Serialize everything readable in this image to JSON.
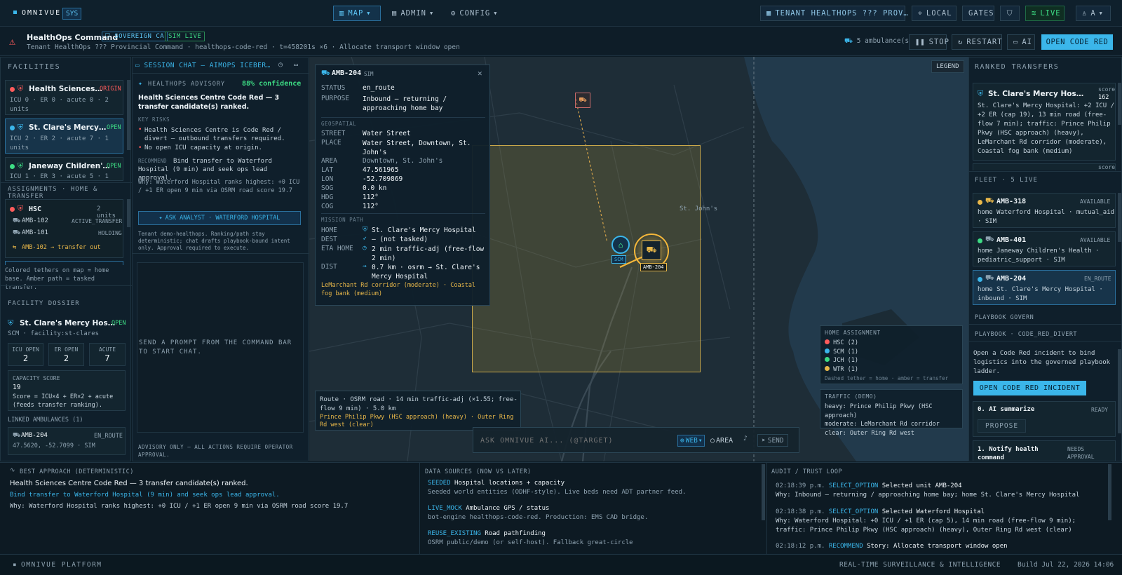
{
  "topbar": {
    "brand": "OMNIVUE",
    "sys": "SYS",
    "nav": [
      "MAP",
      "ADMIN",
      "CONFIG"
    ],
    "tenant": "TENANT HEALTHOPS ??? PROV…",
    "local": "LOCAL",
    "gates": "GATES",
    "live": "LIVE",
    "user": "A"
  },
  "command": {
    "title": "HealthOps Command",
    "badge_ca": "SOVEREIGN CA",
    "badge_sim": "SIM LIVE",
    "subtitle": "Tenant HealthOps ??? Provincial Command · healthops-code-red · t=458201s ×6 · Allocate transport window open",
    "ambulances": "5 ambulance(s)",
    "stop": "STOP",
    "restart": "RESTART",
    "ai": "AI",
    "open_code_red": "OPEN CODE RED"
  },
  "facilities": {
    "title": "FACILITIES",
    "items": [
      {
        "name": "Health Sciences…",
        "status": "ORIGIN",
        "detail": "ICU 0 · ER 0 · acute 0 · 2 units"
      },
      {
        "name": "St. Clare's Mercy…",
        "status": "OPEN",
        "detail": "ICU 2 · ER 2 · acute 7 · 1 units"
      },
      {
        "name": "Janeway Children'…",
        "status": "OPEN",
        "detail": "ICU 1 · ER 3 · acute 5 · 1"
      }
    ]
  },
  "assignments": {
    "title": "ASSIGNMENTS · HOME & TRANSFER",
    "group": "HSC",
    "group_units": "2 units",
    "units": [
      {
        "id": "AMB-102",
        "state": "ACTIVE_TRANSFER"
      },
      {
        "id": "AMB-101",
        "state": "HOLDING"
      }
    ],
    "transfer_note": "AMB-102 → transfer out",
    "legend_note": "Colored tethers on map = home base. Amber path = tasked transfer."
  },
  "dossier": {
    "title": "FACILITY DOSSIER",
    "name": "St. Clare's Mercy Hos…",
    "status": "OPEN",
    "code": "SCM · facility:st-clares",
    "stats": [
      {
        "label": "ICU OPEN",
        "value": "2"
      },
      {
        "label": "ER OPEN",
        "value": "2"
      },
      {
        "label": "ACUTE",
        "value": "7"
      }
    ],
    "capacity_label": "CAPACITY SCORE",
    "capacity_value": "19",
    "capacity_formula": "Score = ICU×4 + ER×2 + acute (feeds transfer ranking).",
    "linked_title": "LINKED AMBULANCES (1)",
    "linked_id": "AMB-204",
    "linked_state": "EN_ROUTE",
    "linked_pos": "47.5620, -52.7099 · SIM"
  },
  "chat": {
    "title": "SESSION CHAT — AIMOPS ICEBER…",
    "advisory": "HEALTHOPS ADVISORY",
    "confidence": "88% confidence",
    "headline": "Health Sciences Centre Code Red — 3 transfer candidate(s) ranked.",
    "key_risks_title": "KEY RISKS",
    "risks": [
      "Health Sciences Centre is Code Red / divert — outbound transfers required.",
      "No open ICU capacity at origin."
    ],
    "recommend_label": "RECOMMEND",
    "recommend": "Bind transfer to Waterford Hospital (9 min) and seek ops lead approval.",
    "why": "Why: Waterford Hospital ranks highest: +0 ICU / +1 ER open 9 min via OSRM road score 19.7",
    "ask_btn": "ASK ANALYST · WATERFORD HOSPITAL",
    "note": "Tenant demo-healthops. Ranking/path stay deterministic; chat drafts playbook-bound intent only. Approval required to execute.",
    "empty": "SEND A PROMPT FROM THE COMMAND BAR TO START CHAT.",
    "footer": "ADVISORY ONLY — ALL ACTIONS REQUIRE OPERATOR APPROVAL."
  },
  "popup": {
    "title": "AMB-204",
    "tag": "SIM",
    "status_k": "STATUS",
    "status_v": "en_route",
    "purpose_k": "PURPOSE",
    "purpose_v": "Inbound — returning / approaching home bay",
    "geo_title": "GEOSPATIAL",
    "street_k": "STREET",
    "street_v": "Water Street",
    "place_k": "PLACE",
    "place_v": "Water Street, Downtown, St. John's",
    "area_k": "AREA",
    "area_v": "Downtown, St. John's",
    "lat_k": "LAT",
    "lat_v": "47.561965",
    "lon_k": "LON",
    "lon_v": "-52.709869",
    "sog_k": "SOG",
    "sog_v": "0.0 kn",
    "hdg_k": "HDG",
    "hdg_v": "112°",
    "cog_k": "COG",
    "cog_v": "112°",
    "mission_title": "MISSION PATH",
    "home_k": "HOME",
    "home_v": "St. Clare's Mercy Hospital",
    "dest_k": "DEST",
    "dest_v": "— (not tasked)",
    "eta_k": "ETA HOME",
    "eta_v": "2 min traffic-adj (free-flow 2 min)",
    "dist_k": "DIST",
    "dist_v": "0.7 km · osrm → St. Clare's Mercy Hospital",
    "traffic_note": "LeMarchant Rd corridor (moderate) · Coastal fog bank (medium)"
  },
  "map": {
    "legend_btn": "LEGEND",
    "city_label": "St. John's",
    "home_marker": "SCM",
    "amb_marker": "AMB-204",
    "route_text": "Route · OSRM road · 14 min traffic-adj (×1.55; free-flow 9 min) · 5.0 km",
    "route_note": "Prince Philip Pkwy (HSC approach) (heavy) · Outer Ring Rd west (clear)",
    "ask_placeholder": "ASK OMNIVUE AI... (@TARGET)",
    "web": "WEB",
    "area": "AREA",
    "send": "SEND",
    "home_assign_title": "HOME ASSIGNMENT",
    "home_assign": [
      {
        "label": "HSC (2)",
        "color": "#ff5b5b"
      },
      {
        "label": "SCM (1)",
        "color": "#3bb6ea"
      },
      {
        "label": "JCH (1)",
        "color": "#3ddc84"
      },
      {
        "label": "WTR (1)",
        "color": "#e9b84a"
      }
    ],
    "home_assign_note": "Dashed tether = home · amber = transfer",
    "traffic_title": "TRAFFIC (DEMO)",
    "traffic": [
      "heavy: Prince Philip Pkwy (HSC approach)",
      "moderate: LeMarchant Rd corridor",
      "clear: Outer Ring Rd west"
    ]
  },
  "ranked": {
    "title": "RANKED TRANSFERS",
    "name": "St. Clare's Mercy Hos…",
    "score_label": "score",
    "score": "162",
    "desc": "St. Clare's Mercy Hospital: +2 ICU / +2 ER (cap 19), 13 min road (free-flow 7 min); traffic: Prince Philip Pkwy (HSC approach) (heavy), LeMarchant Rd corridor (moderate), Coastal fog bank (medium)",
    "score_label2": "score"
  },
  "fleet": {
    "title": "FLEET · 5 LIVE",
    "items": [
      {
        "id": "AMB-318",
        "state": "AVAILABLE",
        "detail": "home Waterford Hospital · mutual_aid · SIM",
        "color": "#e9b84a"
      },
      {
        "id": "AMB-401",
        "state": "AVAILABLE",
        "detail": "home Janeway Children's Health · pediatric_support · SIM",
        "color": "#3ddc84"
      },
      {
        "id": "AMB-204",
        "state": "EN_ROUTE",
        "detail": "home St. Clare's Mercy Hospital · inbound · SIM",
        "color": "#3bb6ea"
      }
    ]
  },
  "playbook": {
    "govern": "PLAYBOOK GOVERN",
    "title": "PLAYBOOK · CODE_RED_DIVERT",
    "desc": "Open a Code Red incident to bind logistics into the governed playbook ladder.",
    "btn": "OPEN CODE RED INCIDENT",
    "step0": "0. AI summarize",
    "step0_state": "READY",
    "propose": "PROPOSE",
    "step1": "1. Notify health command",
    "step1_state": "NEEDS APPROVAL"
  },
  "best": {
    "title": "BEST APPROACH (DETERMINISTIC)",
    "headline": "Health Sciences Centre Code Red — 3 transfer candidate(s) ranked.",
    "action": "Bind transfer to Waterford Hospital (9 min) and seek ops lead approval.",
    "why": "Why: Waterford Hospital ranks highest: +0 ICU / +1 ER open 9 min via OSRM road score 19.7"
  },
  "sources": {
    "title": "DATA SOURCES (NOW VS LATER)",
    "items": [
      {
        "tag": "SEEDED",
        "name": "Hospital locations + capacity",
        "desc": "Seeded world entities (ODHF-style). Live beds need ADT partner feed."
      },
      {
        "tag": "LIVE_MOCK",
        "name": "Ambulance GPS / status",
        "desc": "bot-engine healthops-code-red. Production: EMS CAD bridge."
      },
      {
        "tag": "REUSE_EXISTING",
        "name": "Road pathfinding",
        "desc": "OSRM public/demo (or self-host). Fallback great-circle"
      }
    ]
  },
  "audit": {
    "title": "AUDIT / TRUST LOOP",
    "items": [
      {
        "time": "02:18:39 p.m.",
        "kind": "SELECT_OPTION",
        "text": "Selected unit AMB-204",
        "why": "Why: Inbound — returning / approaching home bay; home St. Clare's Mercy Hospital"
      },
      {
        "time": "02:18:38 p.m.",
        "kind": "SELECT_OPTION",
        "text": "Selected Waterford Hospital",
        "why": "Why: Waterford Hospital: +0 ICU / +1 ER (cap 5), 14 min road (free-flow 9 min); traffic: Prince Philip Pkwy (HSC approach) (heavy), Outer Ring Rd west (clear)"
      },
      {
        "time": "02:18:12 p.m.",
        "kind": "RECOMMEND",
        "text": "Story: Allocate transport window open",
        "why": ""
      }
    ]
  },
  "footer": {
    "left": "OMNIVUE PLATFORM",
    "right": "REAL-TIME SURVEILLANCE & INTELLIGENCE",
    "build": "Build Jul 22, 2026 14:06"
  }
}
